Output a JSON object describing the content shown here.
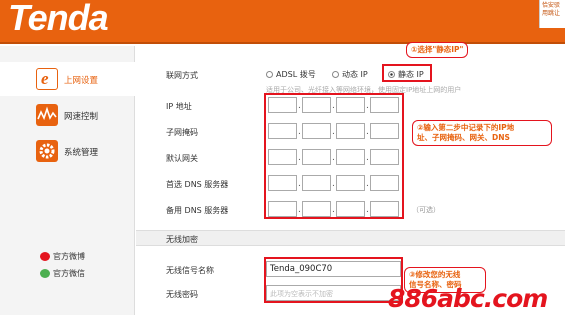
{
  "brand": {
    "logo": "Tenda",
    "top_right": "恰安驳用跳让"
  },
  "sidebar": {
    "items": [
      {
        "label": "上网设置"
      },
      {
        "label": "网速控制"
      },
      {
        "label": "系统管理"
      }
    ],
    "social": [
      {
        "label": "官方微博"
      },
      {
        "label": "官方微信"
      }
    ]
  },
  "wan": {
    "mode_label": "联网方式",
    "modes": [
      "ADSL 拨号",
      "动态 IP",
      "静态 IP"
    ],
    "selected_mode": "静态 IP",
    "hint": "适用于公司、光纤接入等网络环境，使用固定IP地址上网的用户",
    "fields": [
      {
        "label": "IP 地址"
      },
      {
        "label": "子网掩码"
      },
      {
        "label": "默认网关"
      },
      {
        "label": "首选 DNS 服务器"
      },
      {
        "label": "备用 DNS 服务器"
      }
    ],
    "optional": "（可选）"
  },
  "wireless": {
    "section_title": "无线加密",
    "ssid_label": "无线信号名称",
    "ssid_value": "Tenda_090C70",
    "password_label": "无线密码",
    "password_placeholder": "此项为空表示不加密"
  },
  "callouts": {
    "c1": "①选择\"静态IP\"",
    "c2_line1": "②输入第二步中记录下的IP地",
    "c2_line2": "址、子网掩码、网关、DNS",
    "c3_line1": "③修改您的无线",
    "c3_line2": "信号名称、密码"
  },
  "watermark": "886abc.com",
  "colors": {
    "brand": "#e8620f",
    "highlight": "#e4141e"
  }
}
